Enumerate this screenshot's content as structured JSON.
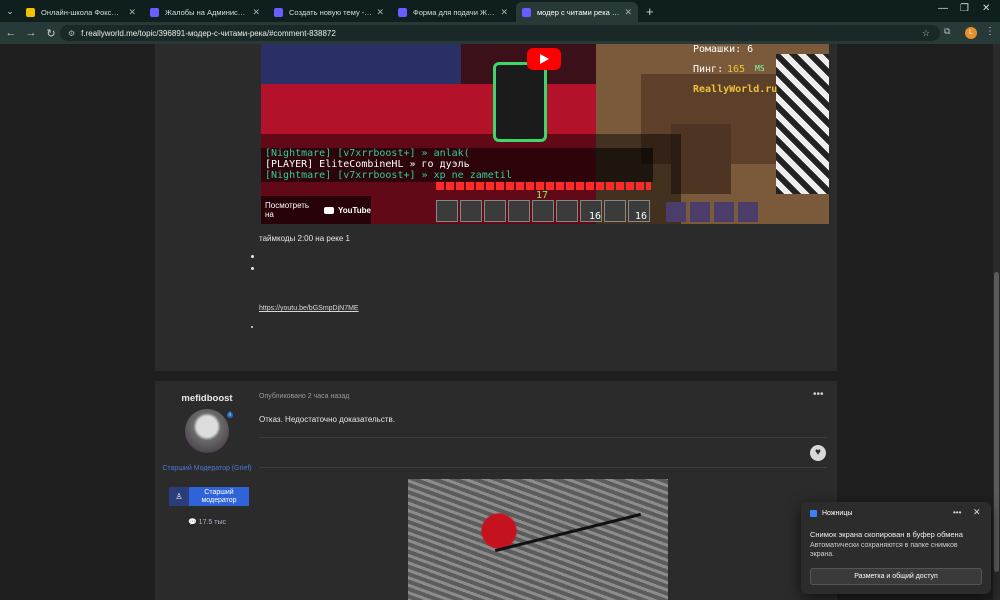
{
  "browser": {
    "tabs": [
      {
        "title": "Онлайн-школа Фоксфорд",
        "color": "#f2c200"
      },
      {
        "title": "Жалобы на Администрацию",
        "color": "#6b5cff"
      },
      {
        "title": "Создать новую тему - ReallyW",
        "color": "#6b5cff"
      },
      {
        "title": "Форма для подачи Жалобы н",
        "color": "#6b5cff"
      },
      {
        "title": "модер с читами река - Жалоб",
        "color": "#6b5cff",
        "active": true
      }
    ],
    "url": "f.reallyworld.me/topic/396891-модер-с-читами-река/#comment-838872",
    "profile_letter": "L"
  },
  "post1": {
    "video": {
      "stat_camomile": "Ромашки: 6",
      "stat_ping_label": "Пинг:",
      "stat_ping_value": "165",
      "stat_ms": "MS",
      "brand": "ReallyWorld.ru",
      "chat": [
        "[Nightmare] [v7xrrboost+] » anlak(",
        "[PLAYER] EliteCombineHL » го дуэль",
        "[Nightmare] [v7xrrboost+] » xp ne zametil"
      ],
      "level": "17",
      "slot1": "16",
      "slot2": "16",
      "watch_on": "Посмотреть на",
      "youtube": "YouTube"
    },
    "text": "таймкоды 2:00 на реке 1",
    "link": "https://youtu.be/bGSmpDjN7ME"
  },
  "post2": {
    "author": "mefidboost",
    "role": "Старший Модератор (Grief)",
    "badge": "Старший модератор",
    "reputation": "17.5 тыс",
    "meta": "Опубликовано 2 часа назад",
    "text": "Отказ. Недостаточно доказательств."
  },
  "toast": {
    "app": "Ножницы",
    "title": "Снимок экрана скопирован в буфер обмена",
    "body": "Автоматически сохраняются в папке снимков экрана.",
    "button": "Разметка и общий доступ"
  }
}
